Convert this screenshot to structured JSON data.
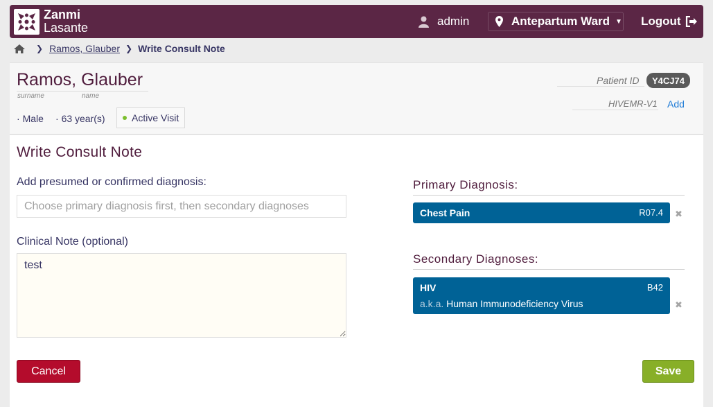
{
  "header": {
    "logo_line1": "Zanmi",
    "logo_line2": "Lasante",
    "user": "admin",
    "location": "Antepartum Ward",
    "logout": "Logout"
  },
  "breadcrumb": {
    "patient": "Ramos, Glauber",
    "current": "Write Consult Note"
  },
  "patient": {
    "name": "Ramos, Glauber",
    "surname_label": "surname",
    "name_label": "name",
    "gender": "Male",
    "age": "63 year(s)",
    "visit_status": "Active Visit",
    "patient_id_label": "Patient ID",
    "patient_id": "Y4CJ74",
    "other_id_label": "HIVEMR-V1",
    "add_label": "Add"
  },
  "form": {
    "title": "Write Consult Note",
    "diagnosis_label": "Add presumed or confirmed diagnosis:",
    "diagnosis_placeholder": "Choose primary diagnosis first, then secondary diagnoses",
    "note_label": "Clinical Note (optional)",
    "note_value": "test",
    "cancel": "Cancel",
    "save": "Save"
  },
  "diagnoses": {
    "primary_title": "Primary Diagnosis:",
    "primary": {
      "name": "Chest Pain",
      "code": "R07.4"
    },
    "secondary_title": "Secondary Diagnoses:",
    "secondary": [
      {
        "name": "HIV",
        "code": "B42",
        "aka_prefix": "a.k.a.",
        "aka": "Human Immunodeficiency Virus"
      }
    ],
    "remove_glyph": "✖"
  },
  "colors": {
    "header_bg": "#5b2645",
    "diagnosis_bg": "#006296",
    "cancel_bg": "#b40c2c",
    "save_bg": "#88af28"
  }
}
